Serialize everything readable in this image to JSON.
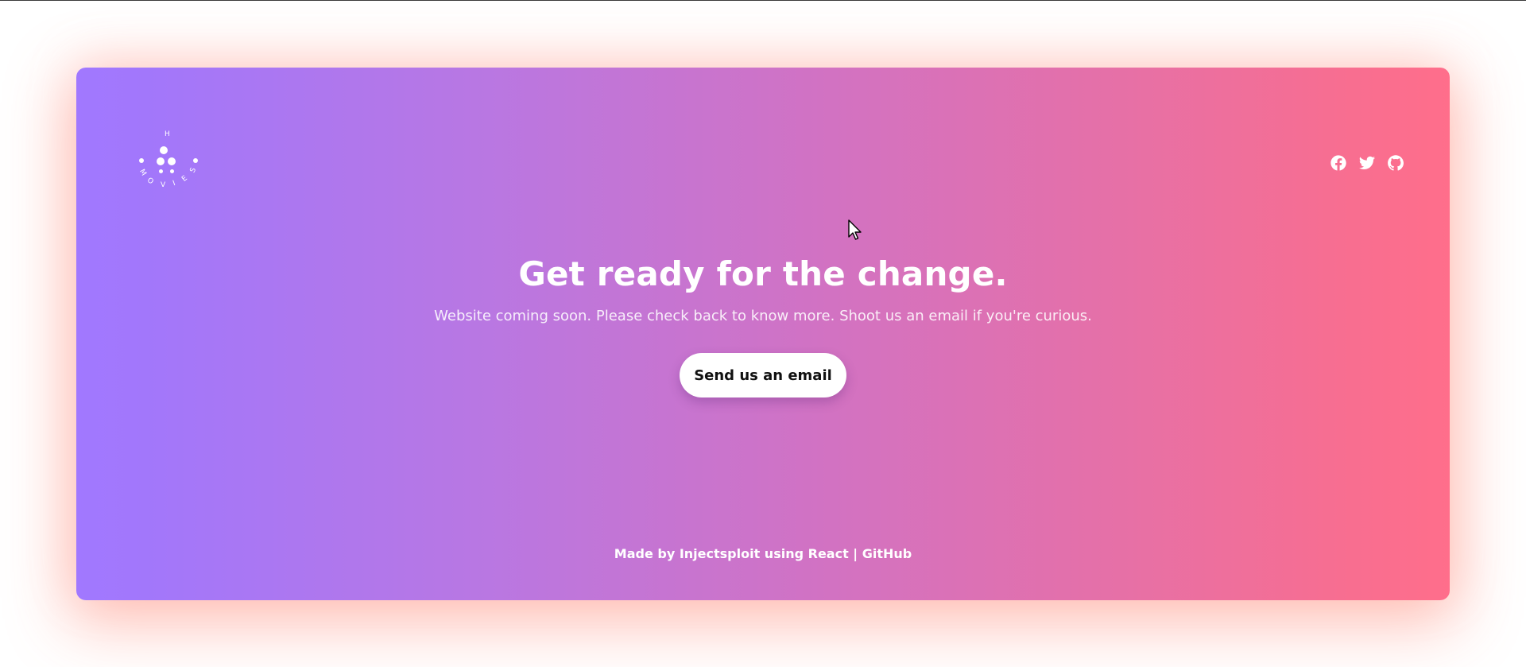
{
  "logo": {
    "letters_top": "H",
    "letters_arc": [
      "M",
      "O",
      "V",
      "I",
      "E",
      "S"
    ]
  },
  "social": [
    {
      "name": "facebook",
      "icon": "facebook-icon"
    },
    {
      "name": "twitter",
      "icon": "twitter-icon"
    },
    {
      "name": "github",
      "icon": "github-icon"
    }
  ],
  "hero": {
    "headline": "Get ready for the change.",
    "subtitle": "Website coming soon. Please check back to know more. Shoot us an email if you're curious.",
    "cta_label": "Send us an email"
  },
  "footer": {
    "made_by": "Made by ",
    "author": "Injectsploit",
    "using": " using ",
    "tech": "React",
    "separator": " | ",
    "github_link": "GitHub"
  },
  "colors": {
    "gradient_start": "#a178ff",
    "gradient_end": "#ff6e8b",
    "button_bg": "#ffffff",
    "text": "#ffffff"
  }
}
